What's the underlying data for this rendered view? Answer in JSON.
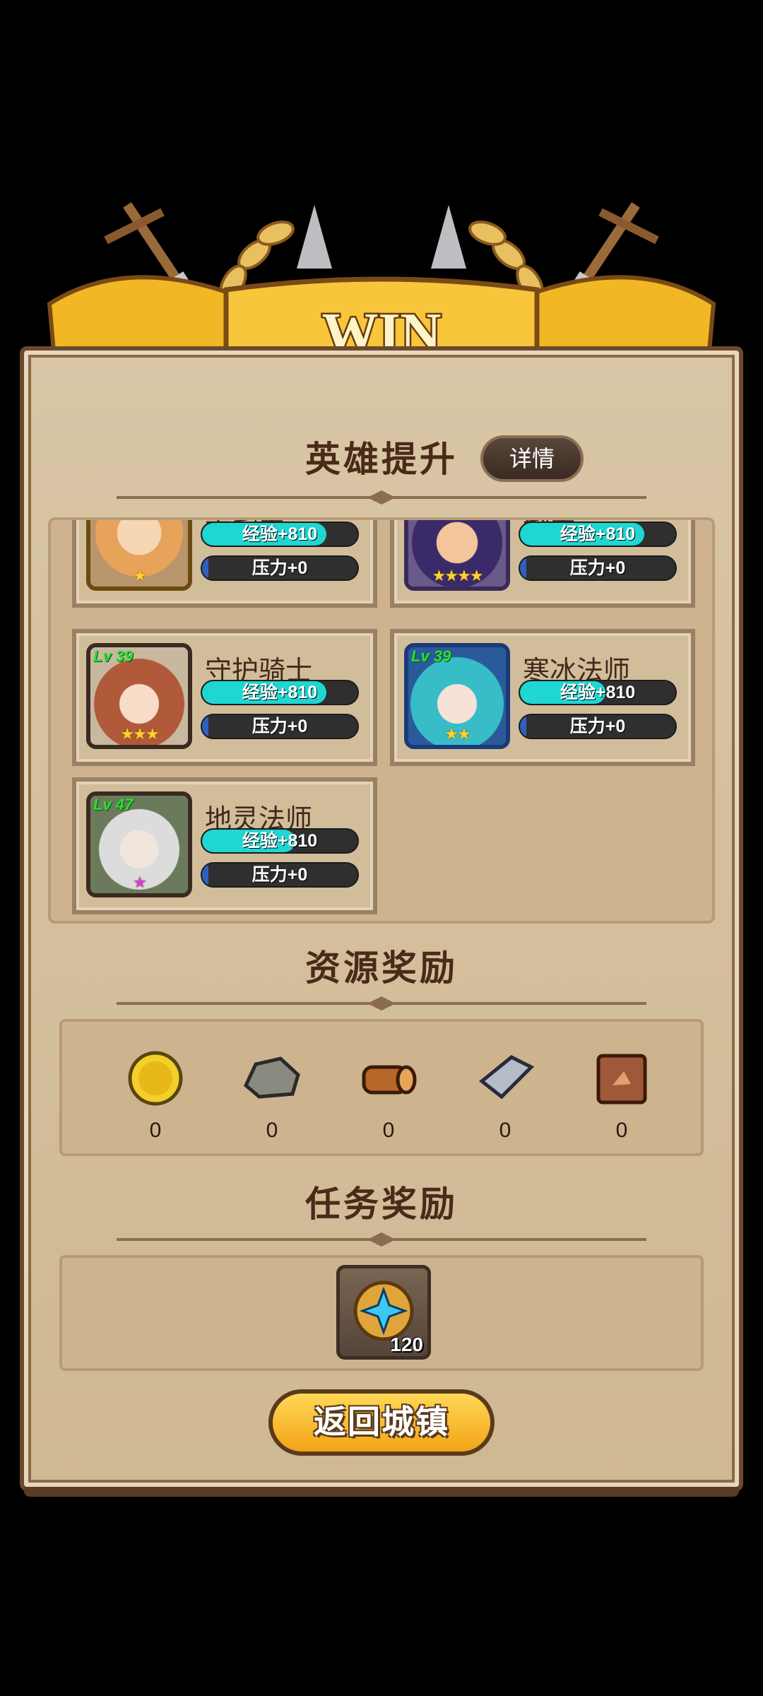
{
  "banner": {
    "title": "WIN"
  },
  "hero_section": {
    "title": "英雄提升",
    "details_label": "详情",
    "heroes": [
      {
        "name": "重剑士",
        "level": "",
        "exp": "经验+810",
        "exp_ratio": 0.8,
        "pressure": "压力+0",
        "pressure_ratio": 0.04,
        "stars": "★"
      },
      {
        "name": "武士",
        "level": "",
        "exp": "经验+810",
        "exp_ratio": 0.8,
        "pressure": "压力+0",
        "pressure_ratio": 0.04,
        "stars": "★★★★"
      },
      {
        "name": "守护骑士",
        "level": "Lv 39",
        "exp": "经验+810",
        "exp_ratio": 0.8,
        "pressure": "压力+0",
        "pressure_ratio": 0.04,
        "stars": "★★★"
      },
      {
        "name": "寒冰法师",
        "level": "Lv 39",
        "exp": "经验+810",
        "exp_ratio": 0.55,
        "pressure": "压力+0",
        "pressure_ratio": 0.04,
        "stars": "★★"
      },
      {
        "name": "地灵法师",
        "level": "Lv 47",
        "exp": "经验+810",
        "exp_ratio": 0.6,
        "pressure": "压力+0",
        "pressure_ratio": 0.04,
        "stars": "★"
      }
    ]
  },
  "resource_section": {
    "title": "资源奖励",
    "items": [
      {
        "icon": "gold-coin-icon",
        "count": "0"
      },
      {
        "icon": "stone-ore-icon",
        "count": "0"
      },
      {
        "icon": "wood-log-icon",
        "count": "0"
      },
      {
        "icon": "iron-ingot-icon",
        "count": "0"
      },
      {
        "icon": "leather-hide-icon",
        "count": "0"
      }
    ]
  },
  "task_section": {
    "title": "任务奖励",
    "item": {
      "icon": "star-medal-icon",
      "count": "120"
    }
  },
  "return_button": {
    "label": "返回城镇"
  },
  "colors": {
    "exp_fill": "#1ed6d2",
    "pressure_fill": "#2f5fbf",
    "gold": "#f3b21a"
  }
}
